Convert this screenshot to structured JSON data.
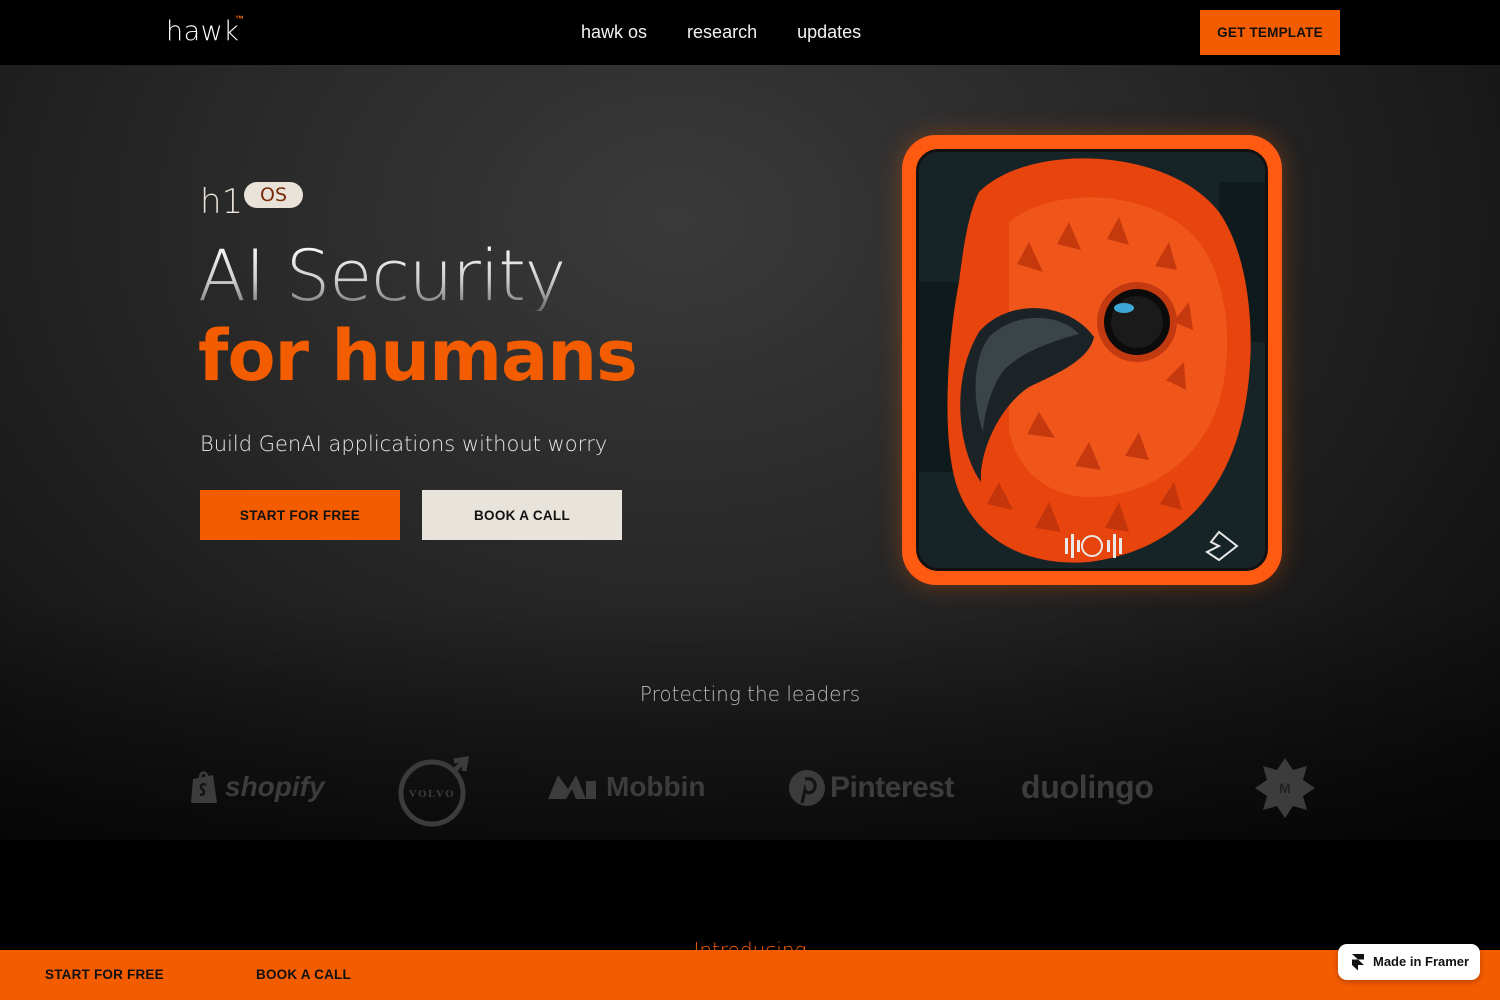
{
  "nav": {
    "logo": "hawk",
    "logo_mark": "™",
    "links": [
      "hawk os",
      "research",
      "updates"
    ],
    "cta": "GET TEMPLATE"
  },
  "hero": {
    "product_prefix": "h1",
    "product_badge": "OS",
    "headline_line1": "AI Security",
    "headline_line2": "for humans",
    "subheadline": "Build GenAI applications without worry",
    "primary_button": "START FOR FREE",
    "secondary_button": "BOOK A CALL",
    "card_image": "orange-hawk-portrait-card"
  },
  "leaders": {
    "title": "Protecting the leaders",
    "logos": [
      "shopify",
      "VOLVO",
      "Mobbin",
      "Pinterest",
      "duolingo",
      "M"
    ]
  },
  "introducing": "Introducing",
  "bottom_bar": {
    "start": "START FOR FREE",
    "book": "BOOK A CALL"
  },
  "badge": {
    "label": "Made in Framer"
  },
  "colors": {
    "accent": "#f45c00",
    "background": "#000000",
    "cream": "#e8e4dc"
  }
}
